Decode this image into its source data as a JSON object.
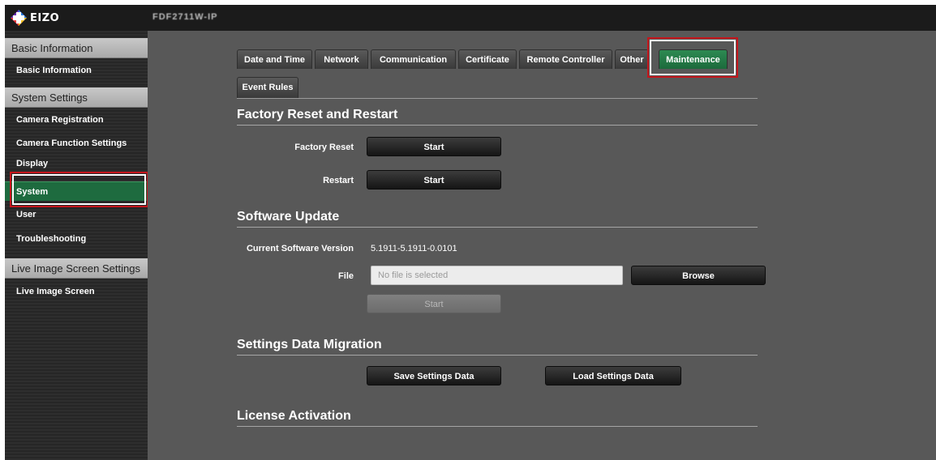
{
  "header": {
    "logo_text": "EIZO",
    "device_name": "FDF2711W-IP"
  },
  "sidebar": {
    "sections": [
      {
        "title": "Basic Information"
      },
      {
        "title": "System Settings"
      },
      {
        "title": "Live Image Screen Settings"
      }
    ],
    "items": [
      {
        "label": "Basic Information"
      },
      {
        "label": "Camera Registration"
      },
      {
        "label": "Camera Function Settings"
      },
      {
        "label": "Display"
      },
      {
        "label": "System"
      },
      {
        "label": "User"
      },
      {
        "label": "Troubleshooting"
      },
      {
        "label": "Live Image Screen"
      }
    ],
    "active_item": "System"
  },
  "tabs": [
    {
      "label": "Date and Time"
    },
    {
      "label": "Network"
    },
    {
      "label": "Communication"
    },
    {
      "label": "Certificate"
    },
    {
      "label": "Remote Controller"
    },
    {
      "label": "Other"
    },
    {
      "label": "Maintenance"
    },
    {
      "label": "Event Rules"
    }
  ],
  "active_tab": "Maintenance",
  "factory_reset": {
    "title": "Factory Reset and Restart",
    "factory_reset_label": "Factory Reset",
    "factory_reset_button": "Start",
    "restart_label": "Restart",
    "restart_button": "Start"
  },
  "software_update": {
    "title": "Software Update",
    "version_label": "Current Software Version",
    "version_value": "5.1911-5.1911-0.0101",
    "file_label": "File",
    "file_placeholder": "No file is selected",
    "browse_button": "Browse",
    "start_button": "Start"
  },
  "migration": {
    "title": "Settings Data Migration",
    "save_button": "Save Settings Data",
    "load_button": "Load Settings Data"
  },
  "license": {
    "title": "License Activation"
  },
  "colors": {
    "accent_green": "#1e6b3f",
    "highlight_red": "#c4161c",
    "background": "#585858"
  }
}
